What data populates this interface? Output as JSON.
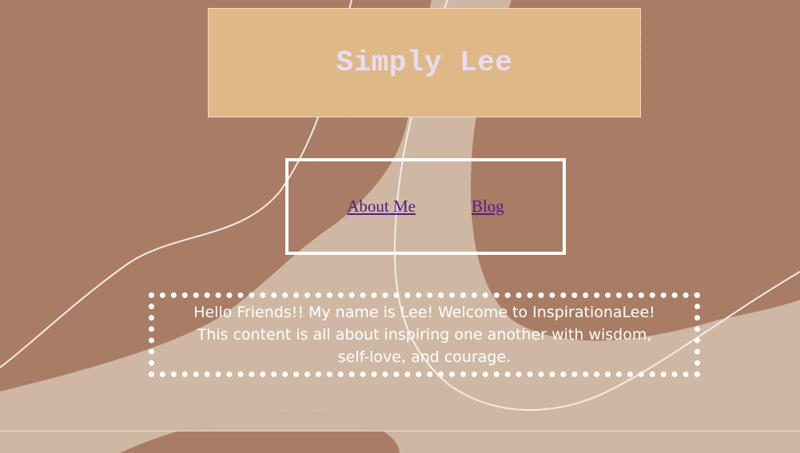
{
  "header": {
    "title": "Simply Lee"
  },
  "nav": {
    "links": [
      {
        "label": "About Me"
      },
      {
        "label": "Blog"
      }
    ]
  },
  "intro": {
    "text": "Hello Friends!! My name is Lee! Welcome to InspirationaLee! This content is all about inspiring one another with wisdom, self-love, and courage."
  },
  "colors": {
    "background": "#a87c65",
    "shape_light": "#cfb8a3",
    "title_box": "#dfb887",
    "title_text": "#e8dcf1",
    "link": "#551a8b",
    "border": "#ffffff"
  }
}
